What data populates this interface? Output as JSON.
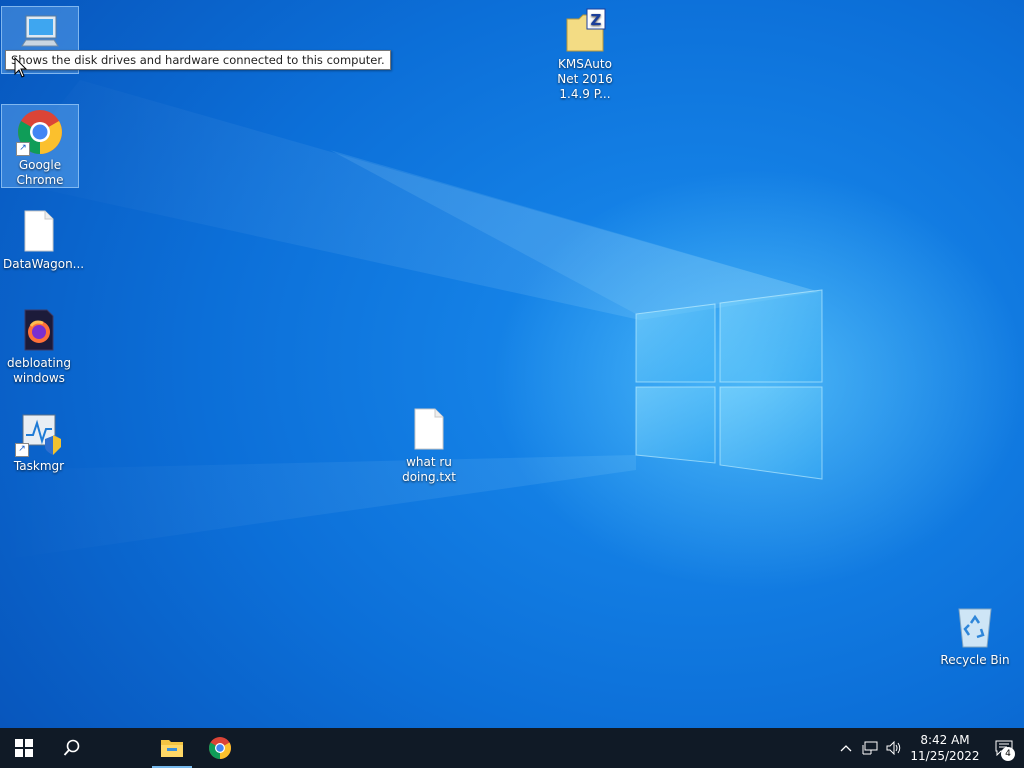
{
  "desktop": {
    "icons": [
      {
        "label": "",
        "name": "this-pc-icon"
      },
      {
        "label": "Google Chrome",
        "name": "google-chrome-icon"
      },
      {
        "label": "DataWagon...",
        "name": "datawagon-file-icon"
      },
      {
        "label": "debloating windows",
        "name": "debloating-windows-icon"
      },
      {
        "label": "Taskmgr",
        "name": "taskmgr-icon"
      },
      {
        "label": "KMSAuto Net 2016 1.4.9 P...",
        "name": "kmsauto-archive-icon"
      },
      {
        "label": "what ru doing.txt",
        "name": "text-file-icon"
      },
      {
        "label": "Recycle Bin",
        "name": "recycle-bin-icon"
      }
    ],
    "tooltip": "Shows the disk drives and hardware connected to this computer."
  },
  "taskbar": {
    "start": "start-button",
    "search": "search-button",
    "pinned": [
      {
        "name": "file-explorer-icon",
        "running": true
      },
      {
        "name": "chrome-icon",
        "running": false
      }
    ],
    "tray": {
      "icons": [
        "chevron-up-icon",
        "network-icon",
        "volume-icon"
      ],
      "time": "8:42 AM",
      "date": "11/25/2022",
      "notification_count": "4"
    }
  },
  "colors": {
    "wallpaper": "#0a6fd6",
    "taskbar": "#101a26",
    "accent": "#76b9ed"
  }
}
